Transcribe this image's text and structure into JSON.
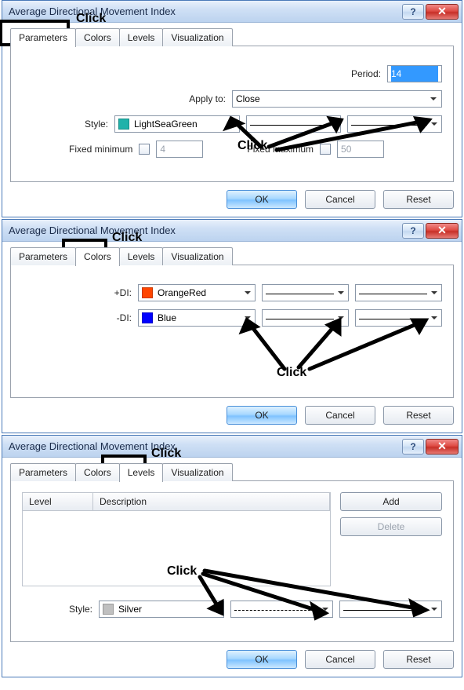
{
  "dialogs": [
    {
      "title": "Average Directional Movement Index",
      "tabs": [
        "Parameters",
        "Colors",
        "Levels",
        "Visualization"
      ],
      "active_tab": 0,
      "buttons": {
        "ok": "OK",
        "cancel": "Cancel",
        "reset": "Reset"
      },
      "annotations": {
        "tab_click": "Click",
        "combo_click": "Click"
      },
      "fields": {
        "period_label": "Period:",
        "period_value": "14",
        "apply_label": "Apply to:",
        "apply_value": "Close",
        "style_label": "Style:",
        "style_color_name": "LightSeaGreen",
        "style_color_hex": "#20B2AA",
        "fixed_min_label": "Fixed minimum",
        "fixed_min_value": "4",
        "fixed_max_label": "Fixed maximum",
        "fixed_max_value": "50"
      }
    },
    {
      "title": "Average Directional Movement Index",
      "tabs": [
        "Parameters",
        "Colors",
        "Levels",
        "Visualization"
      ],
      "active_tab": 1,
      "buttons": {
        "ok": "OK",
        "cancel": "Cancel",
        "reset": "Reset"
      },
      "annotations": {
        "tab_click": "Click",
        "combo_click": "Click"
      },
      "lines": [
        {
          "label": "+DI:",
          "color_name": "OrangeRed",
          "color_hex": "#FF4500"
        },
        {
          "label": "-DI:",
          "color_name": "Blue",
          "color_hex": "#0000FF"
        }
      ]
    },
    {
      "title": "Average Directional Movement Index",
      "tabs": [
        "Parameters",
        "Colors",
        "Levels",
        "Visualization"
      ],
      "active_tab": 2,
      "buttons": {
        "ok": "OK",
        "cancel": "Cancel",
        "reset": "Reset",
        "add": "Add",
        "delete": "Delete"
      },
      "annotations": {
        "tab_click": "Click",
        "combo_click": "Click"
      },
      "table": {
        "col_level": "Level",
        "col_desc": "Description"
      },
      "style": {
        "label": "Style:",
        "color_name": "Silver",
        "color_hex": "#C0C0C0"
      }
    }
  ]
}
